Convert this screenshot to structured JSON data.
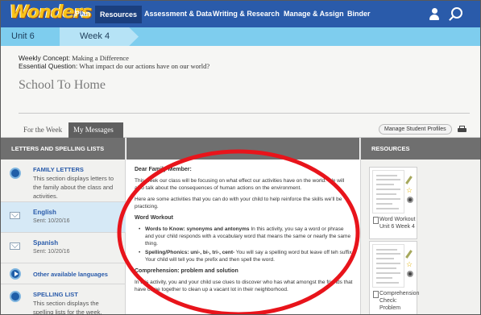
{
  "nav": {
    "logo": "Wonders",
    "items": [
      "Plan",
      "Resources",
      "Assessment & Data",
      "Writing & Research",
      "Manage & Assign",
      "Binder"
    ],
    "active": "Resources",
    "icons": [
      "user-icon",
      "search-icon"
    ],
    "color": "#2a5baa"
  },
  "unitbar": {
    "unit": "Unit 6",
    "week": "Week 4"
  },
  "concept": {
    "weekly_label": "Weekly Concept:",
    "weekly_value": " Making a Difference",
    "question_label": "Essential Question:",
    "question_value": " What impact do our actions have on our world?",
    "title": "School To Home"
  },
  "tabs": {
    "for_week": "For the Week",
    "messages": "My Messages",
    "manage": "Manage Student Profiles"
  },
  "left": {
    "header": "LETTERS AND SPELLING LISTS",
    "family_title": "FAMILY LETTERS",
    "family_desc": "This section displays letters to the family about the class and activities.",
    "languages": [
      {
        "name": "English",
        "sent": "Sent: 10/20/16"
      },
      {
        "name": "Spanish",
        "sent": "Sent: 10/20/16"
      }
    ],
    "other_languages": "Other available languages",
    "spelling_title": "SPELLING LIST",
    "spelling_desc": "This section displays the spelling lists for the week."
  },
  "letter": {
    "greeting": "Dear Family Member:",
    "p1": "This week our class will be focusing on what effect our activities have on the world. We will also talk about the consequences of human actions on the environment.",
    "p2": "Here are some activities that you can do with your child to help reinforce the skills we'll be practicing.",
    "workout_head": "Word Workout",
    "b1_label": "Words to Know: synonyms and antonyms",
    "b1_text": " In this activity, you say a word or phrase and your child responds with a vocabulary word that means the same or nearly the same thing.",
    "b2_label": "Spelling/Phonics: uni-, bi-, tri-, cent-",
    "b2_text": " You will say a spelling word but leave off teh suffix. Your child will tell you the prefix and then spell the word.",
    "comp_head": "Comprehension: problem and solution",
    "p3": "In this activity, you and your child use clues to discover who has what amongst the friends that have come together to clean up a vacant lot in their neighborhood."
  },
  "right": {
    "header": "RESOURCES",
    "cards": [
      {
        "title": "Word Workout Unit 6 Week 4"
      },
      {
        "title": "Comprehension Check: Problem"
      }
    ]
  },
  "annotation_color": "#e8141b"
}
